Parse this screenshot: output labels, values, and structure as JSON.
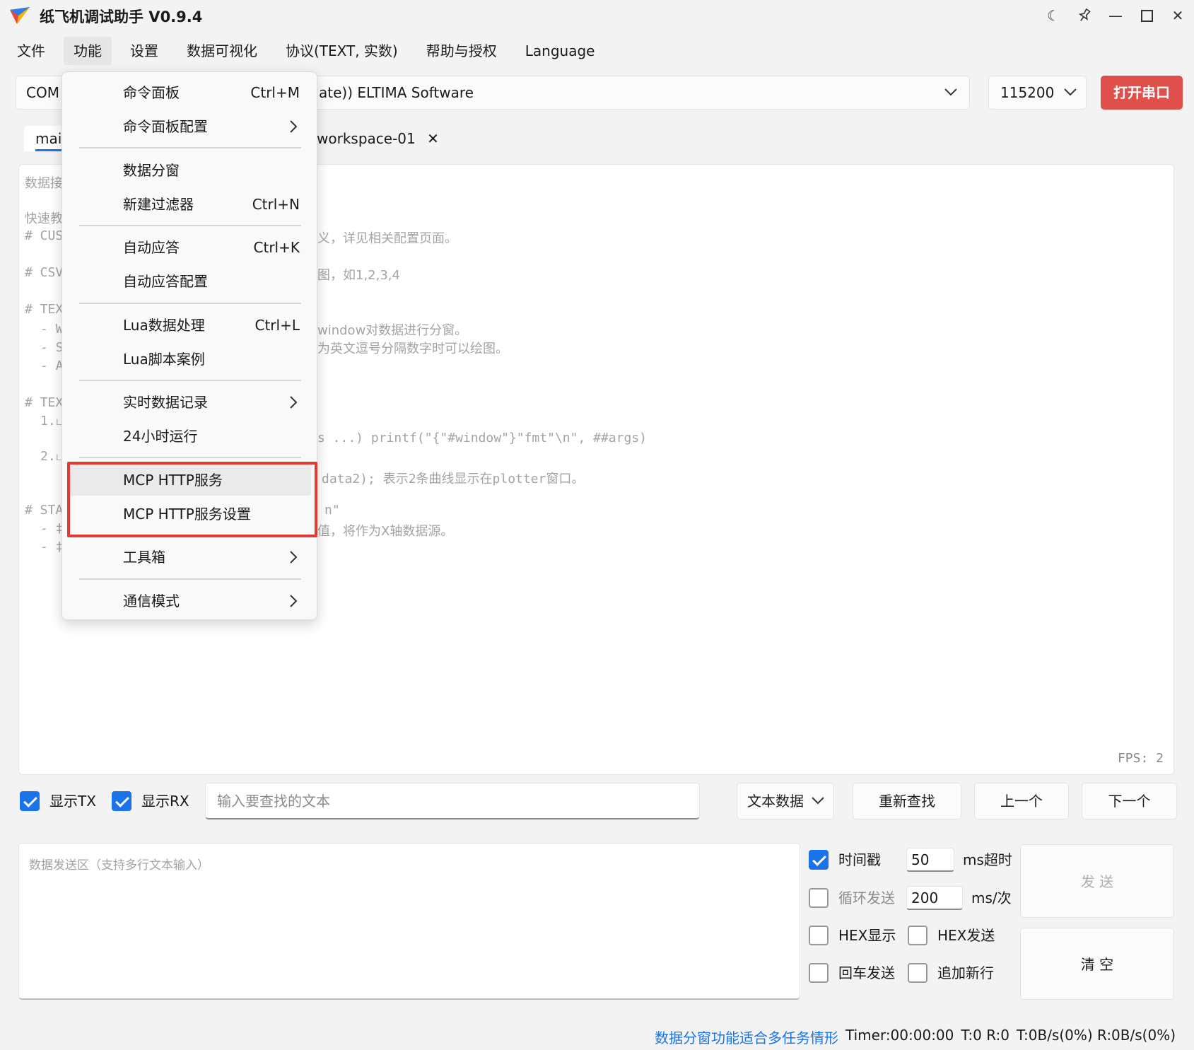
{
  "window": {
    "title": "纸飞机调试助手 V0.9.4"
  },
  "menubar": [
    "文件",
    "功能",
    "设置",
    "数据可视化",
    "协议(TEXT, 实数)",
    "帮助与授权",
    "Language"
  ],
  "port": {
    "left_text": "COM",
    "right_text": "ate)) ELTIMA Software"
  },
  "baud": "115200",
  "open_button": "打开串口",
  "tabs": {
    "main": "mai",
    "workspace": "workspace-01"
  },
  "receive": {
    "lines": [
      "数据接",
      "快速教",
      "# CUS",
      "义，详见相关配置页面。",
      "# CSV",
      "图，如1,2,3,4",
      "# TEX",
      "- W",
      "window对数据进行分窗。",
      "- S",
      "为英文逗号分隔数字时可以绘图。",
      "- A",
      "# TEX",
      "1.ப",
      "s ...) printf(\"{\"#window\"}\"fmt\"\\n\", ##args)",
      "2.ப",
      "data2); 表示2条曲线显示在plotter窗口。",
      "# STA",
      "n\"",
      "- ‡",
      "值，将作为X轴数据源。",
      "- ‡"
    ],
    "fps": "FPS: 2"
  },
  "search": {
    "show_tx": "显示TX",
    "show_rx": "显示RX",
    "placeholder": "输入要查找的文本",
    "mode": "文本数据",
    "re_search": "重新查找",
    "prev": "上一个",
    "next": "下一个"
  },
  "send": {
    "placeholder": "数据发送区（支持多行文本输入）",
    "timestamp": "时间戳",
    "timeout_value": "50",
    "timeout_unit": "ms超时",
    "loop_send": "循环发送",
    "loop_value": "200",
    "loop_unit": "ms/次",
    "hex_display": "HEX显示",
    "hex_send": "HEX发送",
    "enter_send": "回车发送",
    "append_newline": "追加新行",
    "send_button": "发 送",
    "clear_button": "清 空"
  },
  "status": {
    "tip": "数据分窗功能适合多任务情形",
    "timer": "Timer:00:00:00",
    "tr": "T:0 R:0",
    "rate": "T:0B/s(0%) R:0B/s(0%)"
  },
  "dropdown": {
    "items": [
      {
        "label": "命令面板",
        "shortcut": "Ctrl+M"
      },
      {
        "label": "命令面板配置",
        "submenu": true
      },
      {
        "label": "数据分窗"
      },
      {
        "label": "新建过滤器",
        "shortcut": "Ctrl+N"
      },
      {
        "label": "自动应答",
        "shortcut": "Ctrl+K"
      },
      {
        "label": "自动应答配置"
      },
      {
        "label": "Lua数据处理",
        "shortcut": "Ctrl+L"
      },
      {
        "label": "Lua脚本案例"
      },
      {
        "label": "实时数据记录",
        "submenu": true
      },
      {
        "label": "24小时运行"
      },
      {
        "label": "MCP HTTP服务"
      },
      {
        "label": "MCP HTTP服务设置"
      },
      {
        "label": "工具箱",
        "submenu": true
      },
      {
        "label": "通信模式",
        "submenu": true
      }
    ]
  }
}
